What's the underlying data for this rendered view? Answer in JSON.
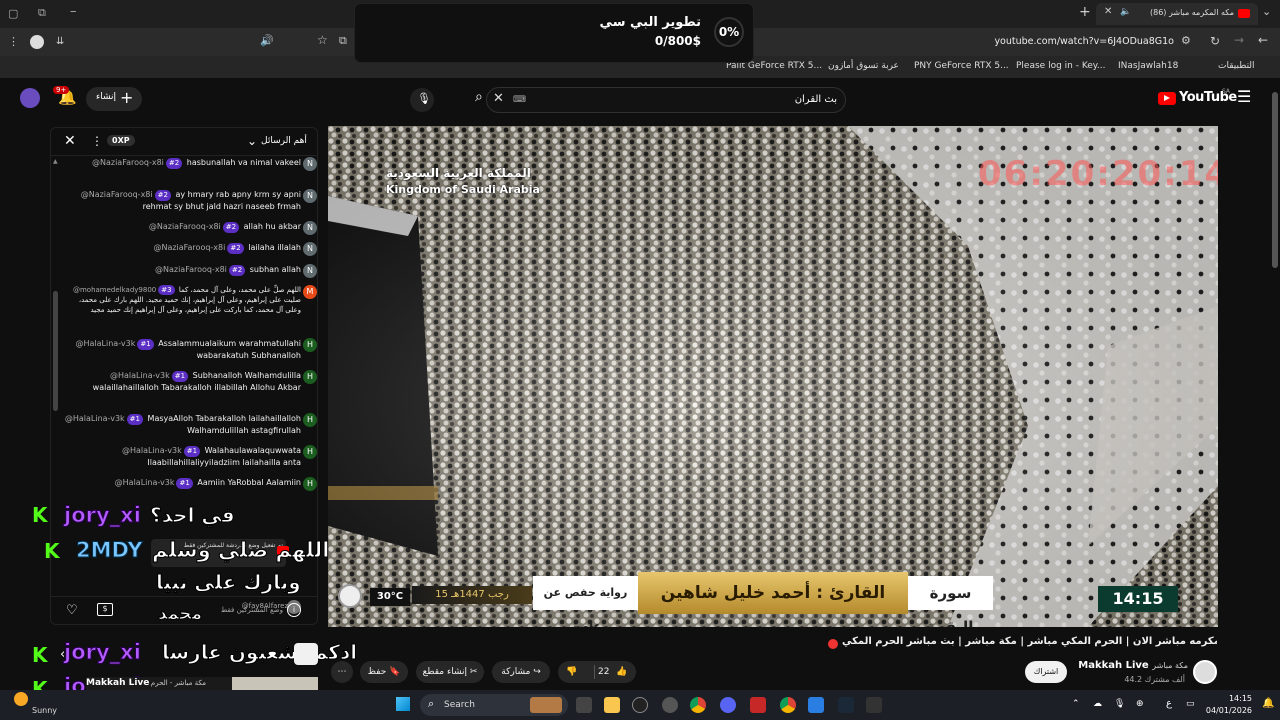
{
  "browser": {
    "tab_title": "(86) مكه المكرمه مباشر",
    "url": "youtube.com/watch?v=6J4ODua8G1o",
    "bookmarks": [
      "التطبيقات",
      "INasJawlah18",
      "Please log in - Key...",
      "PNY GeForce RTX 5...",
      "عربة تسوق أمازون",
      "Palit GeForce RTX 5..."
    ]
  },
  "donation": {
    "title": "تطوير البي سي",
    "amount": "0/800$",
    "percent": "0%"
  },
  "youtube": {
    "logo": "YouTube",
    "country": "SA",
    "search_value": "بث القران",
    "create_label": "إنشاء",
    "notif_count": "9+"
  },
  "chat": {
    "mode_label": "أهم الرسائل",
    "xp_label": "0XP",
    "messages": [
      {
        "author": "@NaziaFarooq-x8i",
        "rank": "#2",
        "text": "hasbunallah va nimal vakeel",
        "avatar": "N",
        "color": "#5f6b6f"
      },
      {
        "author": "@NaziaFarooq-x8i",
        "rank": "#2",
        "text": "ay hmary rab apny krm sy apni rehmat sy bhut jald hazri naseeb frmah",
        "avatar": "N",
        "color": "#5f6b6f"
      },
      {
        "author": "@NaziaFarooq-x8i",
        "rank": "#2",
        "text": "allah hu akbar",
        "avatar": "N",
        "color": "#5f6b6f"
      },
      {
        "author": "@NaziaFarooq-x8i",
        "rank": "#2",
        "text": "lailaha illalah",
        "avatar": "N",
        "color": "#5f6b6f"
      },
      {
        "author": "@NaziaFarooq-x8i",
        "rank": "#2",
        "text": "subhan allah",
        "avatar": "N",
        "color": "#5f6b6f"
      },
      {
        "author": "@mohamedelkady9800",
        "rank": "#3",
        "text": "اللهم صلِّ على محمد، وعلى آل محمد، كما صليت على إبراهيم، وعلى آل إبراهيم، إنك حميد مجيد. اللهم بارك على محمد، وعلى آل محمد، كما باركت على إبراهيم، وعلى آل إبراهيم إنك حميد مجيد",
        "avatar": "M",
        "color": "#e64a19"
      },
      {
        "author": "@HalaLina-v3k",
        "rank": "#1",
        "text": "Assalammualaikum warahmatullahi wabarakatuh Subhanalloh",
        "avatar": "H",
        "color": "#1b5e20"
      },
      {
        "author": "@HalaLina-v3k",
        "rank": "#1",
        "text": "Subhanalloh Walhamdulilla walaillahaillalloh Tabarakalloh illabillah Allohu Akbar",
        "avatar": "H",
        "color": "#1b5e20"
      },
      {
        "author": "@HalaLina-v3k",
        "rank": "#1",
        "text": "MasyaAlloh Tabarakalloh lailahaillalloh Walhamdulillah astagfirullah",
        "avatar": "H",
        "color": "#1b5e20"
      },
      {
        "author": "@HalaLina-v3k",
        "rank": "#1",
        "text": "Walahaulawalaquwwata Ilaabillahillaliyyiladziim lailahailla anta",
        "avatar": "H",
        "color": "#1b5e20"
      },
      {
        "author": "@HalaLina-v3k",
        "rank": "#1",
        "text": "Aamiin YaRobbal Aalamiin",
        "avatar": "H",
        "color": "#1b5e20"
      }
    ],
    "members_only": "وضع المشتركين فقط",
    "last_author": "@fay8Alfarezful",
    "pinned_notice": "تم تفعيل وضع الدردشة للمشتركين فقط"
  },
  "video": {
    "watermark": "المملكة العربية السعودية",
    "watermark_en": "Kingdom of Saudi Arabia",
    "clock": "06:20:20:14",
    "surah": "سورة البقرة",
    "reader": "القارئ : أحمد خليل شاهين",
    "riwaya": "رواية حفص عن عاصم",
    "hijri": "15 رجب 1447هـ",
    "temp": "30°C",
    "time": "14:15"
  },
  "overlay": {
    "user1": "jory_xi",
    "msg1": "في احد؟",
    "user2": "2MDY",
    "msg2": "اللهم صلي وسلم",
    "msg2b": "وبارك على نبيا",
    "msg2c": "محمد",
    "msg3": "ادكم تشعبون عارسا",
    "user3": "jory_xi",
    "user4": "jory_xi"
  },
  "video_info": {
    "title": "مكه المكرمه مباشر الان | الحرم المكي مباشر | مكة مباشر | بث مباشر الحرم المكي 🔴",
    "channel": "Makkah Live",
    "channel_ar": "مكة مباشر",
    "subs": "44.2 ألف مشترك",
    "subscribe": "اشتراك",
    "likes": "22",
    "share": "مشاركة",
    "clip": "إنشاء مقطع",
    "save": "حفظ"
  },
  "mini": {
    "label": "Makkah Live",
    "sub": "مكة مباشر - الحرم"
  },
  "taskbar": {
    "weather": "Sunny",
    "search": "Search",
    "time": "14:15",
    "date": "04/01/2026",
    "lang": "ع"
  }
}
